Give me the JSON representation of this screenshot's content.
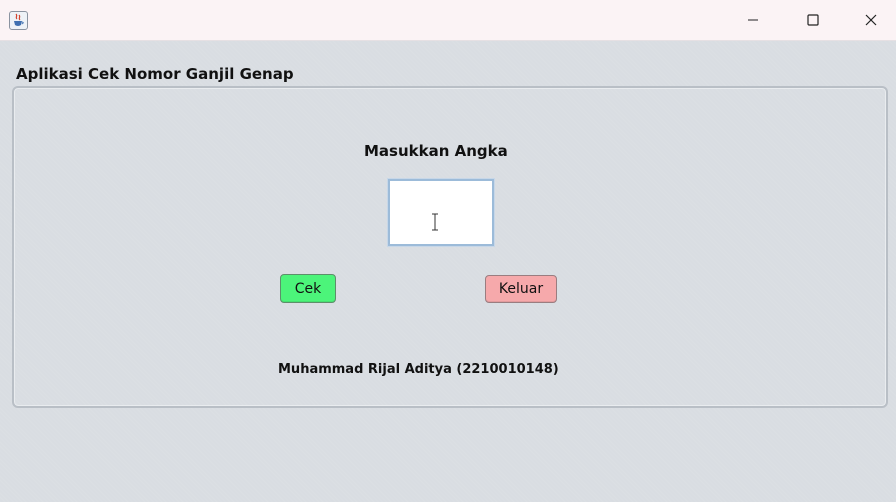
{
  "window": {
    "title": "",
    "icon": "java-cup-icon",
    "controls": {
      "minimize": "minimize-icon",
      "maximize": "maximize-icon",
      "close": "close-icon"
    }
  },
  "app": {
    "title": "Aplikasi Cek Nomor Ganjil Genap"
  },
  "form": {
    "prompt_label": "Masukkan Angka",
    "input_value": "",
    "cek_label": "Cek",
    "keluar_label": "Keluar",
    "cek_color": "#4cf47a",
    "keluar_color": "#f6a9ab"
  },
  "footer": {
    "author": "Muhammad Rijal Aditya (2210010148)"
  }
}
